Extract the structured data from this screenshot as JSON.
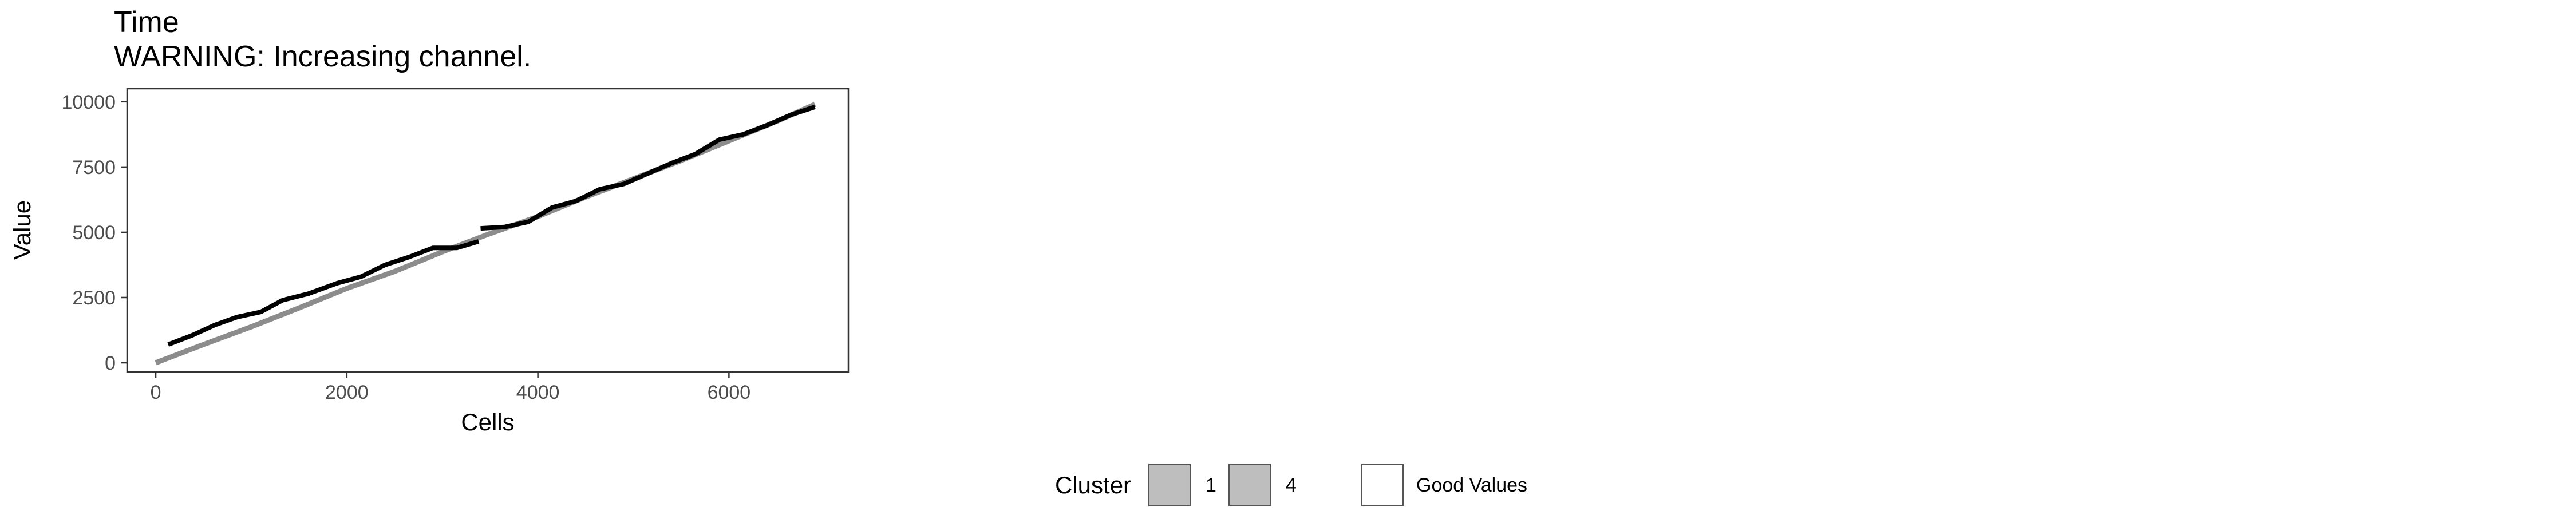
{
  "title": "Time",
  "subtitle": "WARNING: Increasing channel.",
  "legend": {
    "title": "Cluster",
    "items": [
      {
        "label": "1",
        "fill": "#bebebe"
      },
      {
        "label": "4",
        "fill": "#bebebe"
      },
      {
        "label": "Good Values",
        "fill": "#ffffff"
      }
    ]
  },
  "chart_data": {
    "type": "line",
    "xlabel": "Cells",
    "ylabel": "Value",
    "xlim": [
      -300,
      7250
    ],
    "ylim": [
      -350,
      10500
    ],
    "xticks": [
      0,
      2000,
      4000,
      6000
    ],
    "yticks": [
      0,
      2500,
      5000,
      7500,
      10000
    ],
    "grid": false,
    "legend_position": "bottom",
    "colors": {
      "raw": "#8c8c8c",
      "smoothed": "#000000"
    },
    "series": [
      {
        "role": "raw",
        "points": [
          [
            0,
            0
          ],
          [
            500,
            700
          ],
          [
            1000,
            1380
          ],
          [
            1500,
            2100
          ],
          [
            2000,
            2850
          ],
          [
            2500,
            3500
          ],
          [
            3000,
            4250
          ],
          [
            3500,
            4950
          ],
          [
            4000,
            5600
          ],
          [
            4500,
            6350
          ],
          [
            5000,
            7050
          ],
          [
            5500,
            7750
          ],
          [
            6000,
            8500
          ],
          [
            6500,
            9250
          ],
          [
            6900,
            9900
          ]
        ]
      },
      {
        "role": "smoothed",
        "points": [
          [
            130,
            700
          ],
          [
            380,
            1050
          ],
          [
            620,
            1450
          ],
          [
            850,
            1750
          ],
          [
            1100,
            1950
          ],
          [
            1330,
            2400
          ],
          [
            1600,
            2650
          ],
          [
            1900,
            3050
          ],
          [
            2150,
            3300
          ],
          [
            2400,
            3750
          ],
          [
            2650,
            4050
          ],
          [
            2900,
            4400
          ],
          [
            3150,
            4400
          ],
          [
            3380,
            4650
          ]
        ]
      },
      {
        "role": "smoothed",
        "points": [
          [
            3400,
            5150
          ],
          [
            3650,
            5200
          ],
          [
            3900,
            5400
          ],
          [
            4150,
            5950
          ],
          [
            4400,
            6200
          ],
          [
            4650,
            6650
          ],
          [
            4900,
            6850
          ],
          [
            5150,
            7250
          ],
          [
            5400,
            7650
          ],
          [
            5650,
            8000
          ],
          [
            5900,
            8550
          ],
          [
            6150,
            8750
          ],
          [
            6400,
            9100
          ],
          [
            6650,
            9500
          ],
          [
            6900,
            9800
          ]
        ]
      }
    ]
  }
}
